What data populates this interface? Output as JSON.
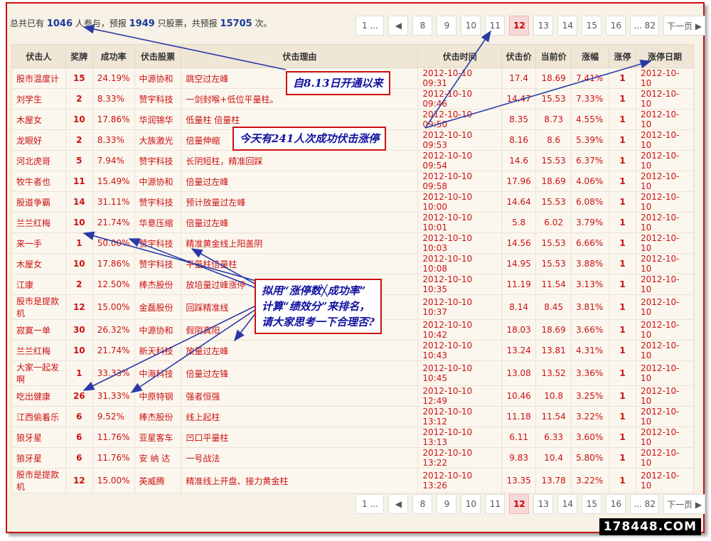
{
  "stats": {
    "prefix": "总共已有 ",
    "participants": "1046",
    "mid1": " 人参与，预报 ",
    "stocks": "1949",
    "mid2": " 只股票，共预报 ",
    "reports": "15705",
    "suffix": " 次。"
  },
  "pager": [
    "1 ...",
    "◀",
    "8",
    "9",
    "10",
    "11",
    "12",
    "13",
    "14",
    "15",
    "16",
    "... 82",
    "下一页 ▶"
  ],
  "pager_current": "12",
  "table": {
    "headers": [
      "伏击人",
      "奖牌",
      "成功率",
      "伏击股票",
      "伏击理由",
      "伏击时间",
      "伏击价",
      "当前价",
      "涨幅",
      "涨停",
      "涨停日期"
    ],
    "rows": [
      [
        "股市温度计",
        "15",
        "24.19%",
        "中源协和",
        "跳空过左峰",
        "2012-10-10 09:31",
        "17.4",
        "18.69",
        "7.41%",
        "1",
        "2012-10-10"
      ],
      [
        "刘学生",
        "2",
        "8.33%",
        "赞宇科技",
        "一剑封喉+低位平量柱。",
        "2012-10-10 09:46",
        "14.47",
        "15.53",
        "7.33%",
        "1",
        "2012-10-10"
      ],
      [
        "木屋女",
        "10",
        "17.86%",
        "华润锦华",
        "低量柱 倍量柱",
        "2012-10-10 09:50",
        "8.35",
        "8.73",
        "4.55%",
        "1",
        "2012-10-10"
      ],
      [
        "龙眼好",
        "2",
        "8.33%",
        "大族激光",
        "倍量伸缩",
        "2012-10-10 09:53",
        "8.16",
        "8.6",
        "5.39%",
        "1",
        "2012-10-10"
      ],
      [
        "河北虎哥",
        "5",
        "7.94%",
        "赞宇科技",
        "长阴短柱，精准回踩",
        "2012-10-10 09:54",
        "14.6",
        "15.53",
        "6.37%",
        "1",
        "2012-10-10"
      ],
      [
        "牧牛者也",
        "11",
        "15.49%",
        "中源协和",
        "倍量过左峰",
        "2012-10-10 09:58",
        "17.96",
        "18.69",
        "4.06%",
        "1",
        "2012-10-10"
      ],
      [
        "股道争霸",
        "14",
        "31.11%",
        "赞宇科技",
        "预计放量过左峰",
        "2012-10-10 10:00",
        "14.64",
        "15.53",
        "6.08%",
        "1",
        "2012-10-10"
      ],
      [
        "兰兰红梅",
        "10",
        "21.74%",
        "华意压缩",
        "倍量过左峰",
        "2012-10-10 10:01",
        "5.8",
        "6.02",
        "3.79%",
        "1",
        "2012-10-10"
      ],
      [
        "来一手",
        "1",
        "50.00%",
        "赞宇科技",
        "精准黄金线上阳盖阴",
        "2012-10-10 10:03",
        "14.56",
        "15.53",
        "6.66%",
        "1",
        "2012-10-10"
      ],
      [
        "木屋女",
        "10",
        "17.86%",
        "赞宇科技",
        "平量柱倍量柱",
        "2012-10-10 10:08",
        "14.95",
        "15.53",
        "3.88%",
        "1",
        "2012-10-10"
      ],
      [
        "江康",
        "2",
        "12.50%",
        "棒杰股份",
        "放培量过峰涨停",
        "2012-10-10 10:35",
        "11.19",
        "11.54",
        "3.13%",
        "1",
        "2012-10-10"
      ],
      [
        "股市是提款机",
        "12",
        "15.00%",
        "金磊股份",
        "回踩精准线",
        "2012-10-10 10:37",
        "8.14",
        "8.45",
        "3.81%",
        "1",
        "2012-10-10"
      ],
      [
        "寂寞一单",
        "30",
        "26.32%",
        "中源协和",
        "假阴真阳",
        "2012-10-10 10:42",
        "18.03",
        "18.69",
        "3.66%",
        "1",
        "2012-10-10"
      ],
      [
        "兰兰红梅",
        "10",
        "21.74%",
        "新天科技",
        "放量过左峰",
        "2012-10-10 10:43",
        "13.24",
        "13.81",
        "4.31%",
        "1",
        "2012-10-10"
      ],
      [
        "大家一起发啊",
        "1",
        "33.33%",
        "中海科技",
        "倍量过左锋",
        "2012-10-10 10:45",
        "13.08",
        "13.52",
        "3.36%",
        "1",
        "2012-10-10"
      ],
      [
        "吃出健康",
        "26",
        "31.33%",
        "中原特钢",
        "强者恒强",
        "2012-10-10 12:49",
        "10.46",
        "10.8",
        "3.25%",
        "1",
        "2012-10-10"
      ],
      [
        "江西偷着乐",
        "6",
        "9.52%",
        "棒杰股份",
        "线上起柱",
        "2012-10-10 13:12",
        "11.18",
        "11.54",
        "3.22%",
        "1",
        "2012-10-10"
      ],
      [
        "狼牙星",
        "6",
        "11.76%",
        "亚星客车",
        "凹口平量柱",
        "2012-10-10 13:13",
        "6.11",
        "6.33",
        "3.60%",
        "1",
        "2012-10-10"
      ],
      [
        "狼牙星",
        "6",
        "11.76%",
        "安 纳 达",
        "一号战法",
        "2012-10-10 13:22",
        "9.83",
        "10.4",
        "5.80%",
        "1",
        "2012-10-10"
      ],
      [
        "股市是提款机",
        "12",
        "15.00%",
        "英威腾",
        "精准线上开盘、接力黄金柱",
        "2012-10-10 13:26",
        "13.35",
        "13.78",
        "3.22%",
        "1",
        "2012-10-10"
      ]
    ]
  },
  "annotations": {
    "a1": "自8.13日开通以来",
    "a2": "今天有241人次成功伏击涨停",
    "a3_l1": "拟用“涨停数╳成功率”",
    "a3_l2": "计算“绩效分”来排名，",
    "a3_l3": "请大家思考一下合理否?"
  },
  "watermark": "178448.COM",
  "colors": {
    "accent": "#cc1111",
    "annotation_text": "#1010a0",
    "header_bg": "#efe6d6",
    "current_page_bg": "#f8d8d8"
  }
}
